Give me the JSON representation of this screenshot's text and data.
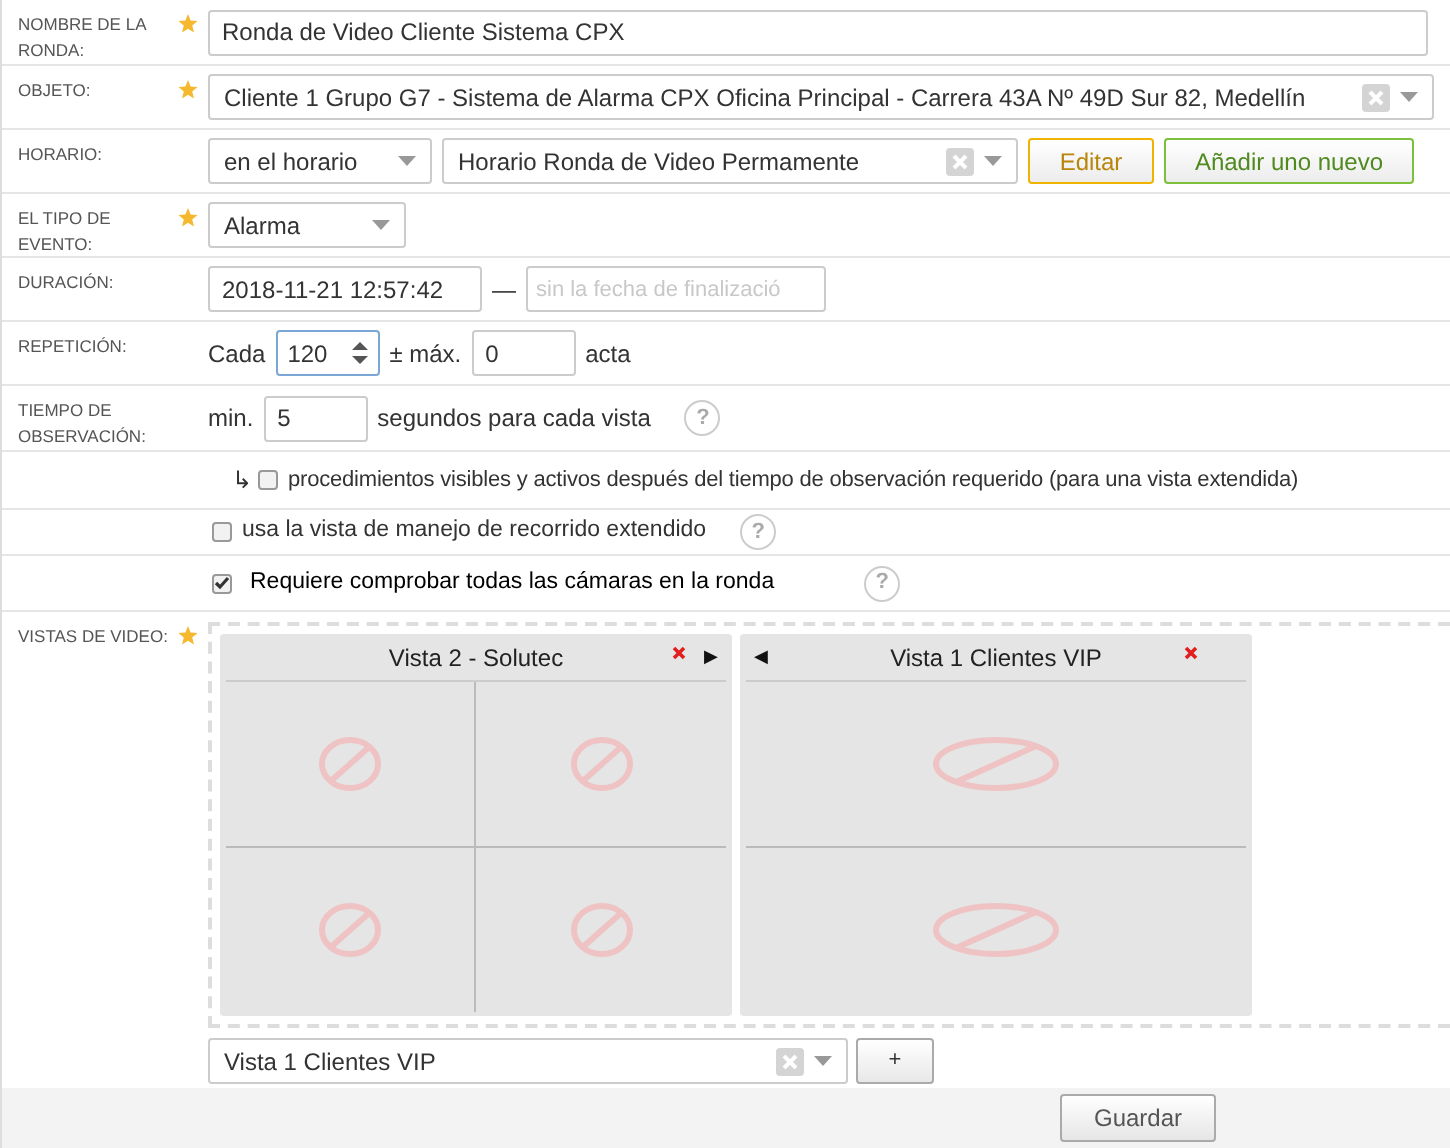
{
  "fields": [
    {
      "kind": "text",
      "label": "NOMBRE DE LA RONDA:",
      "required": true,
      "value": "Ronda de Video Cliente Sistema CPX"
    },
    {
      "kind": "select",
      "label": "OBJETO:",
      "required": true,
      "value": "Cliente 1 Grupo G7 - Sistema de Alarma CPX Oficina Principal - Carrera 43A Nº 49D Sur 82, Medellín"
    },
    {
      "kind": "schedule",
      "label": "HORARIO:",
      "required": false,
      "mode": "en el horario",
      "value": "Horario Ronda de Video Permamente",
      "buttons": [
        {
          "kind": "edit",
          "label": "Editar"
        },
        {
          "kind": "add",
          "label": "Añadir uno nuevo"
        }
      ]
    },
    {
      "kind": "dropdown",
      "label": "EL TIPO DE EVENTO:",
      "required": true,
      "value": "Alarma"
    },
    {
      "kind": "duration",
      "label": "DURACIÓN:",
      "required": false,
      "start": "2018-11-21 12:57:42",
      "separator": "—",
      "end_placeholder": "sin la fecha de finalizació"
    },
    {
      "kind": "repetition",
      "label": "REPETICIÓN:",
      "required": false,
      "prefix": "Cada",
      "value": "120",
      "middle": "± máx.",
      "max": "0",
      "suffix": "acta"
    },
    {
      "kind": "observation",
      "label": "TIEMPO DE OBSERVACIÓN:",
      "required": false,
      "prefix": "min.",
      "value": "5",
      "suffix": "segundos para cada vista",
      "help": "?"
    },
    {
      "kind": "checkbox",
      "marker": "↳",
      "checked": false,
      "text": "procedimientos visibles y activos después del tiempo de observación requerido (para una vista extendida)"
    },
    {
      "kind": "checkbox",
      "checked": false,
      "text": "usa la vista de manejo de recorrido extendido",
      "help": "?"
    },
    {
      "kind": "checkbox",
      "checked": true,
      "text": "Requiere comprobar todas las cámaras en la ronda",
      "help": "?"
    },
    {
      "kind": "views",
      "label": "VISTAS DE VIDEO:",
      "required": true,
      "views": [
        {
          "kind": "quad",
          "title": "Vista 2 - Solutec",
          "next": "▶"
        },
        {
          "kind": "stacked",
          "title": "Vista 1 Clientes VIP",
          "prev": "◀"
        }
      ],
      "picker": "Vista 1 Clientes VIP",
      "add_button": "+"
    }
  ],
  "save_button": "Guardar"
}
